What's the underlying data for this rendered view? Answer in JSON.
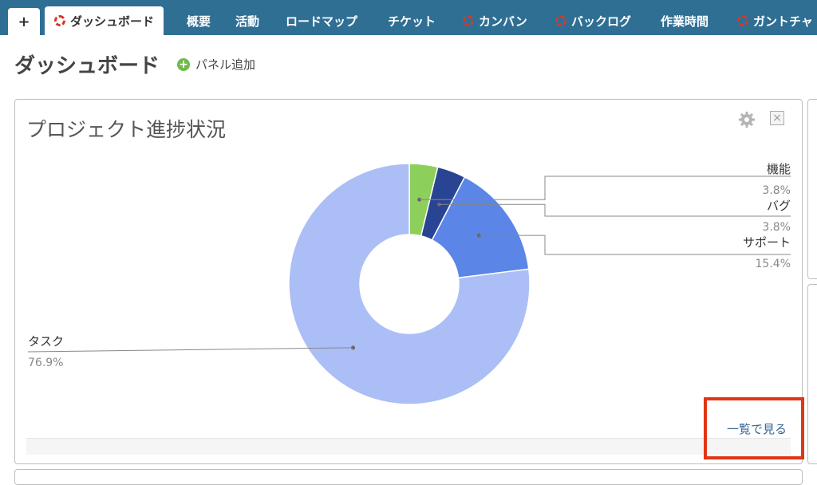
{
  "tabs": {
    "add_label": "+",
    "items": [
      {
        "label": "ダッシュボード",
        "active": true,
        "icon": "redmine-icon"
      },
      {
        "label": "概要"
      },
      {
        "label": "活動"
      },
      {
        "label": "ロードマップ"
      },
      {
        "label": "チケット"
      },
      {
        "label": "カンバン",
        "icon": "redmine-icon"
      },
      {
        "label": "バックログ",
        "icon": "redmine-icon"
      },
      {
        "label": "作業時間"
      },
      {
        "label": "ガントチャ",
        "icon": "redmine-icon"
      }
    ]
  },
  "page": {
    "title": "ダッシュボード",
    "add_panel_label": "パネル追加"
  },
  "panel": {
    "title": "プロジェクト進捗状況",
    "view_all_label": "一覧で見る"
  },
  "colors": {
    "tab_bar": "#2f6f94",
    "highlight": "#e03616"
  },
  "chart_data": {
    "type": "pie",
    "donut": true,
    "slices": [
      {
        "label": "機能",
        "value": 3.8,
        "percent_label": "3.8%",
        "color": "#8ccf5b"
      },
      {
        "label": "バグ",
        "value": 3.8,
        "percent_label": "3.8%",
        "color": "#2a4494"
      },
      {
        "label": "サポート",
        "value": 15.4,
        "percent_label": "15.4%",
        "color": "#5b85e6"
      },
      {
        "label": "タスク",
        "value": 76.9,
        "percent_label": "76.9%",
        "color": "#abbef6"
      }
    ]
  }
}
